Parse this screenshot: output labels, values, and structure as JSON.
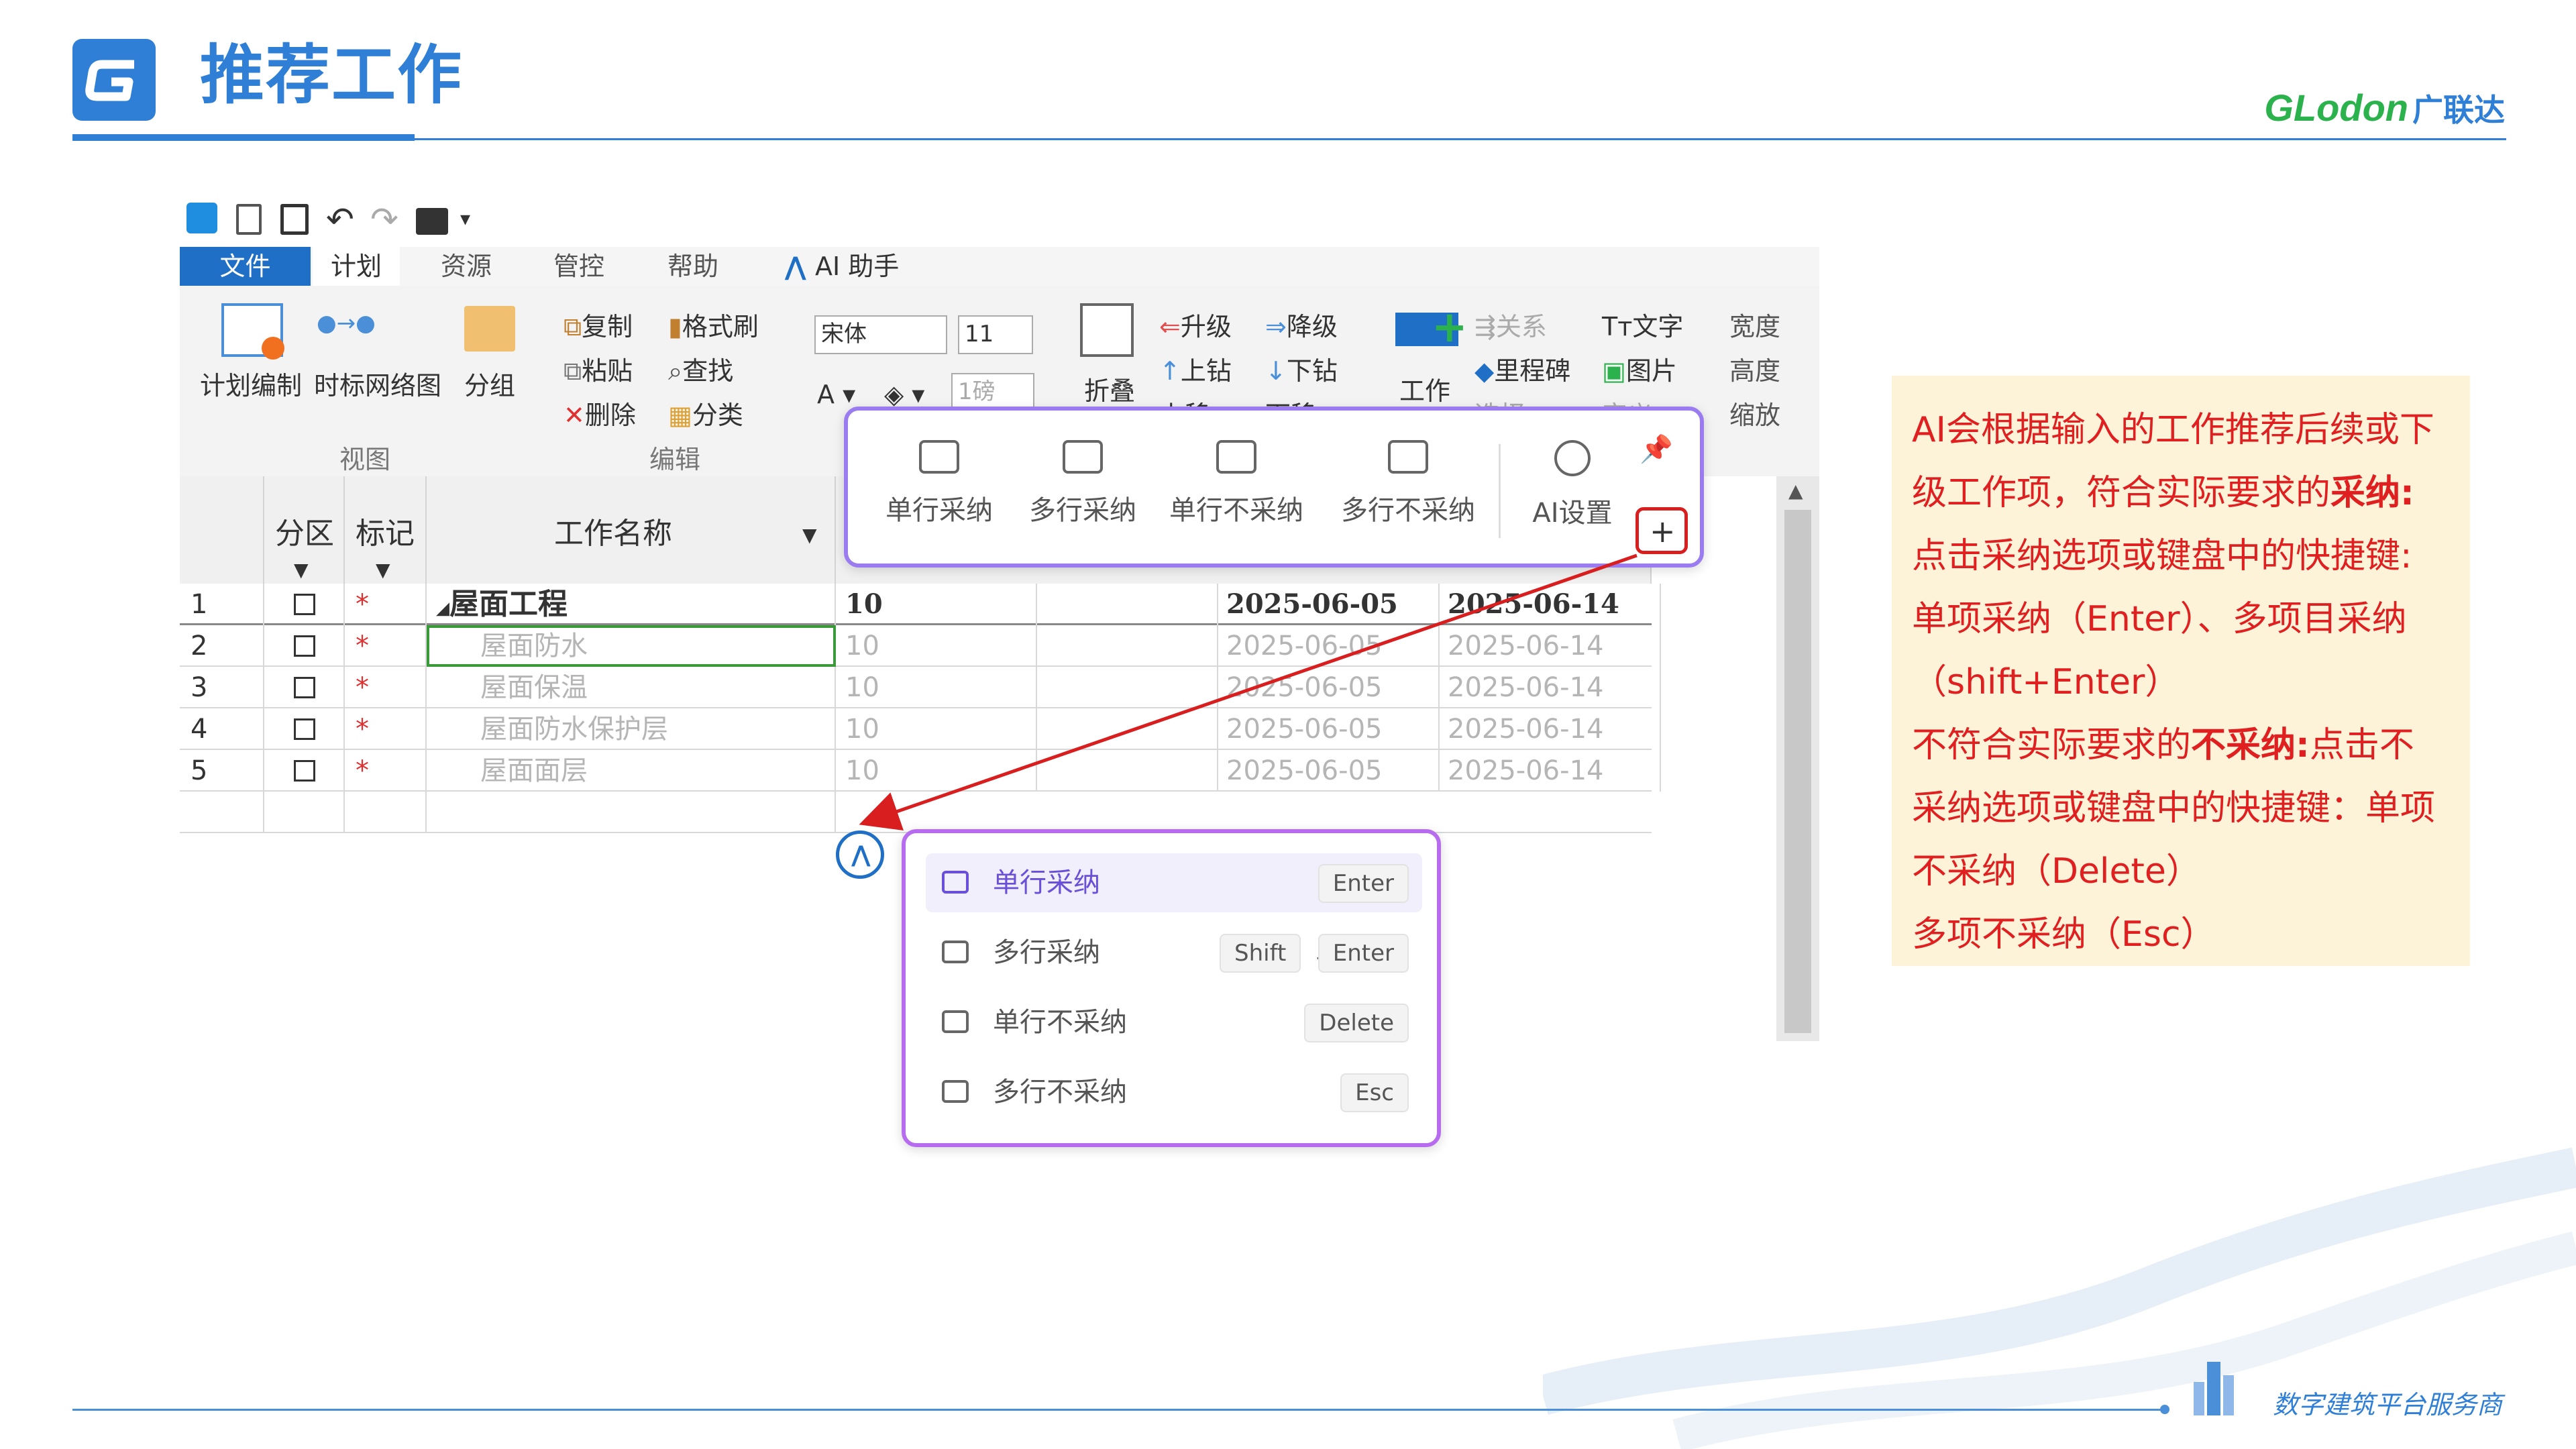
{
  "header": {
    "title": "推荐工作",
    "logo_letter": "G",
    "brand_latin": "GLodon",
    "brand_cn": "广联达"
  },
  "footer": {
    "tagline": "数字建筑平台服务商"
  },
  "app": {
    "menu_tabs": [
      "文件",
      "计划",
      "资源",
      "管控",
      "帮助",
      "AI 助手"
    ],
    "ribbon": {
      "view": {
        "plan_edit": "计划编制",
        "network": "时标网络图",
        "group": "分组",
        "group_label": "视图"
      },
      "edit": {
        "copy": "复制",
        "format_brush": "格式刷",
        "paste": "粘贴",
        "find": "查找",
        "delete": "删除",
        "classify": "分类",
        "group_label": "编辑"
      },
      "font": {
        "name": "宋体",
        "size": "11",
        "size_unit": "1磅"
      },
      "fold": "折叠",
      "level": {
        "up": "升级",
        "down": "降级",
        "drill_up": "上钻",
        "drill_down": "下钻",
        "move_up": "上移",
        "move_down": "下移"
      },
      "insert": {
        "work": "工作",
        "relation": "关系",
        "milestone": "里程碑",
        "select": "选择",
        "text": "文字",
        "picture": "图片",
        "define": "定义"
      },
      "size": {
        "width": "宽度",
        "height": "高度",
        "zoom": "缩放"
      }
    },
    "grid": {
      "columns": {
        "zone": "分区",
        "mark": "标记",
        "name": "工作名称"
      },
      "rows": [
        {
          "num": "1",
          "name": "屋面工程",
          "duration": "10",
          "start": "2025-06-05",
          "end": "2025-06-14",
          "summary": true
        },
        {
          "num": "2",
          "name": "屋面防水",
          "duration": "10",
          "start": "2025-06-05",
          "end": "2025-06-14",
          "summary": false
        },
        {
          "num": "3",
          "name": "屋面保温",
          "duration": "10",
          "start": "2025-06-05",
          "end": "2025-06-14",
          "summary": false
        },
        {
          "num": "4",
          "name": "屋面防水保护层",
          "duration": "10",
          "start": "2025-06-05",
          "end": "2025-06-14",
          "summary": false
        },
        {
          "num": "5",
          "name": "屋面面层",
          "duration": "10",
          "start": "2025-06-05",
          "end": "2025-06-14",
          "summary": false
        }
      ],
      "mark_symbol": "*"
    },
    "ai_toolbar": {
      "items": [
        "单行采纳",
        "多行采纳",
        "单行不采纳",
        "多行不采纳",
        "AI设置"
      ]
    },
    "ai_menu": {
      "items": [
        {
          "label": "单行采纳",
          "keys": [
            "Enter"
          ]
        },
        {
          "label": "多行采纳",
          "keys": [
            "Shift",
            "Enter"
          ]
        },
        {
          "label": "单行不采纳",
          "keys": [
            "Delete"
          ]
        },
        {
          "label": "多行不采纳",
          "keys": [
            "Esc"
          ]
        }
      ],
      "plus": "+"
    }
  },
  "note": {
    "l1": "AI会根据输入的工作推荐后续或下",
    "l2a": "级工作项，符合实际要求的",
    "l2b": "采纳:",
    "l3": "点击采纳选项或键盘中的快捷键:",
    "l4": "单项采纳（Enter）、多项目采纳",
    "l5": "（shift+Enter）",
    "l6a": "不符合实际要求的",
    "l6b": "不采纳:",
    "l6c": "点击不",
    "l7": "采纳选项或键盘中的快捷键：单项",
    "l8": "不采纳（Delete）",
    "l9": "多项不采纳（Esc）"
  },
  "colors": {
    "brand_blue": "#2f7fd7",
    "brand_green": "#2bb24c",
    "note_red": "#e02020",
    "popup_border": "#9a7cf0",
    "arrow": "#d81e1e"
  }
}
